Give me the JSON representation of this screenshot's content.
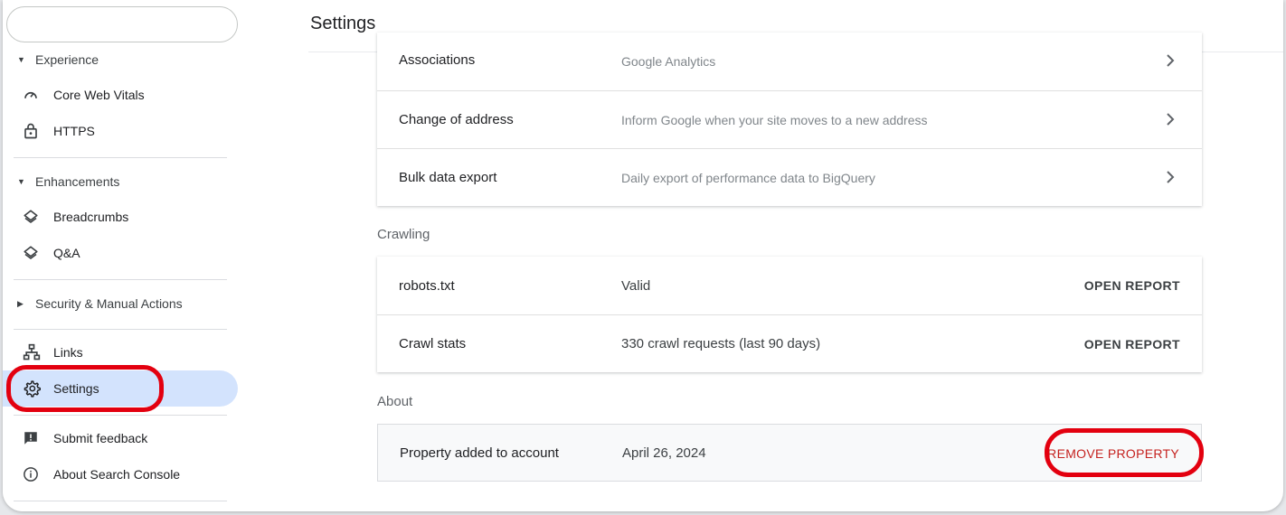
{
  "sidebar": {
    "experience_label": "Experience",
    "experience_items": [
      {
        "label": "Core Web Vitals",
        "icon": "gauge-icon"
      },
      {
        "label": "HTTPS",
        "icon": "lock-icon"
      }
    ],
    "enhancements_label": "Enhancements",
    "enhancements_items": [
      {
        "label": "Breadcrumbs",
        "icon": "layers-icon"
      },
      {
        "label": "Q&A",
        "icon": "layers-icon"
      }
    ],
    "security_label": "Security & Manual Actions",
    "links_label": "Links",
    "settings_label": "Settings",
    "feedback_label": "Submit feedback",
    "about_label": "About Search Console"
  },
  "header": {
    "title": "Settings"
  },
  "general": [
    {
      "label": "Associations",
      "desc": "Google Analytics"
    },
    {
      "label": "Change of address",
      "desc": "Inform Google when your site moves to a new address"
    },
    {
      "label": "Bulk data export",
      "desc": "Daily export of performance data to BigQuery"
    }
  ],
  "crawling": {
    "title": "Crawling",
    "rows": [
      {
        "label": "robots.txt",
        "value": "Valid",
        "action": "OPEN REPORT"
      },
      {
        "label": "Crawl stats",
        "value": "330 crawl requests (last 90 days)",
        "action": "OPEN REPORT"
      }
    ]
  },
  "about": {
    "title": "About",
    "label": "Property added to account",
    "date": "April 26, 2024",
    "action": "REMOVE PROPERTY"
  },
  "colors": {
    "active_nav": "#d3e3fd",
    "annotation_red": "#e3000f",
    "remove_red": "#c5221f"
  }
}
